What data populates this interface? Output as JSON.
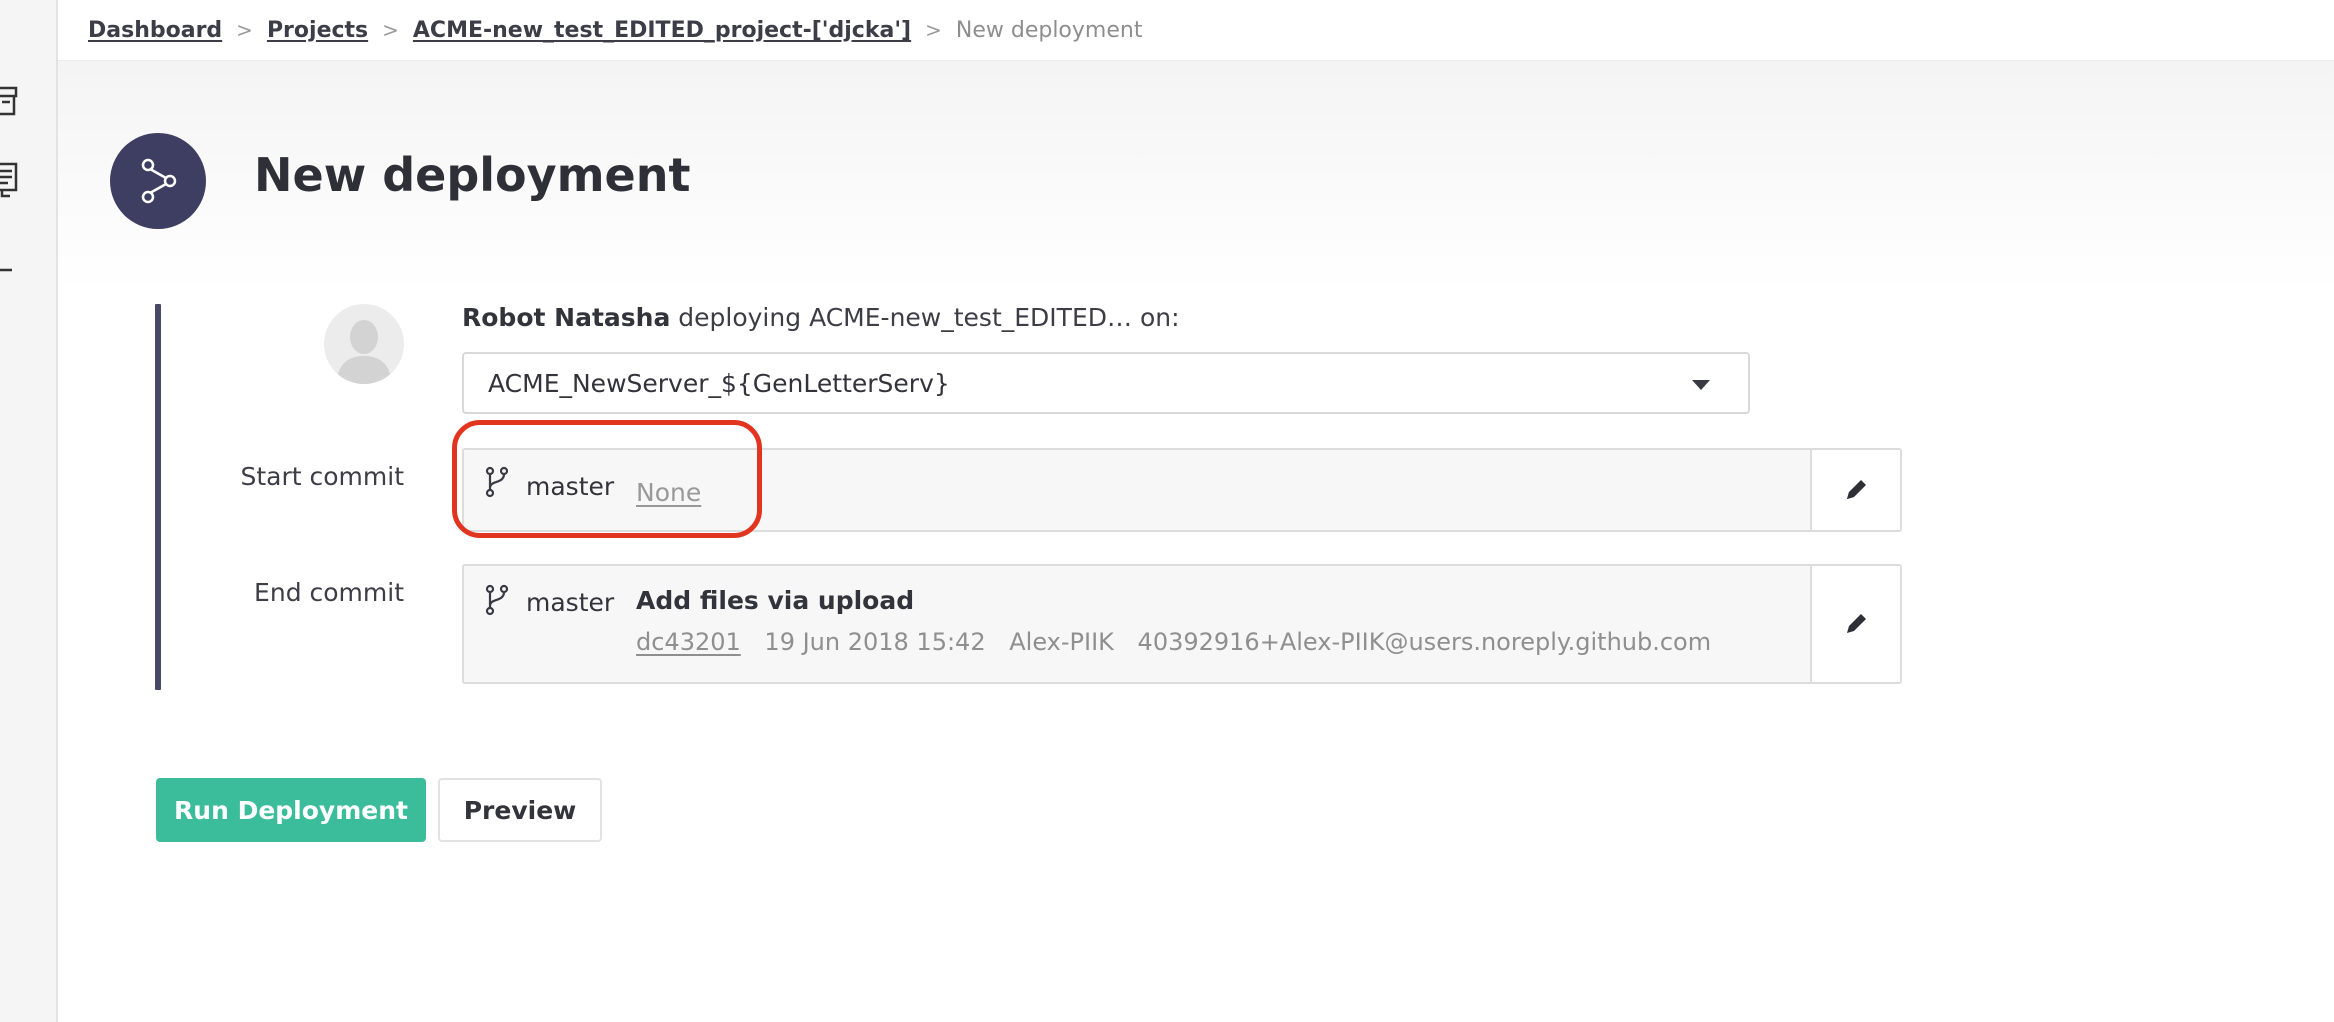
{
  "breadcrumb": {
    "items": [
      "Dashboard",
      "Projects",
      "ACME-new_test_EDITED_project-['djcka']"
    ],
    "current": "New deployment",
    "separator": ">"
  },
  "page": {
    "title": "New deployment",
    "icon": "deployment-branch-icon"
  },
  "deployer": {
    "name": "Robot Natasha",
    "verb": "deploying",
    "project": "ACME-new_test_EDITED…",
    "suffix": "on:"
  },
  "server_select": {
    "value": "ACME_NewServer_${GenLetterServ}"
  },
  "start_commit": {
    "label": "Start commit",
    "branch": "master",
    "commit": "None"
  },
  "end_commit": {
    "label": "End commit",
    "branch": "master",
    "message": "Add files via upload",
    "hash": "dc43201",
    "date": "19 Jun 2018 15:42",
    "author": "Alex-PIIK",
    "email": "40392916+Alex-PIIK@users.noreply.github.com"
  },
  "actions": {
    "run": "Run Deployment",
    "preview": "Preview"
  },
  "colors": {
    "accent": "#3bbd9b",
    "header_icon": "#3e3e63",
    "highlight": "#e2351f"
  }
}
